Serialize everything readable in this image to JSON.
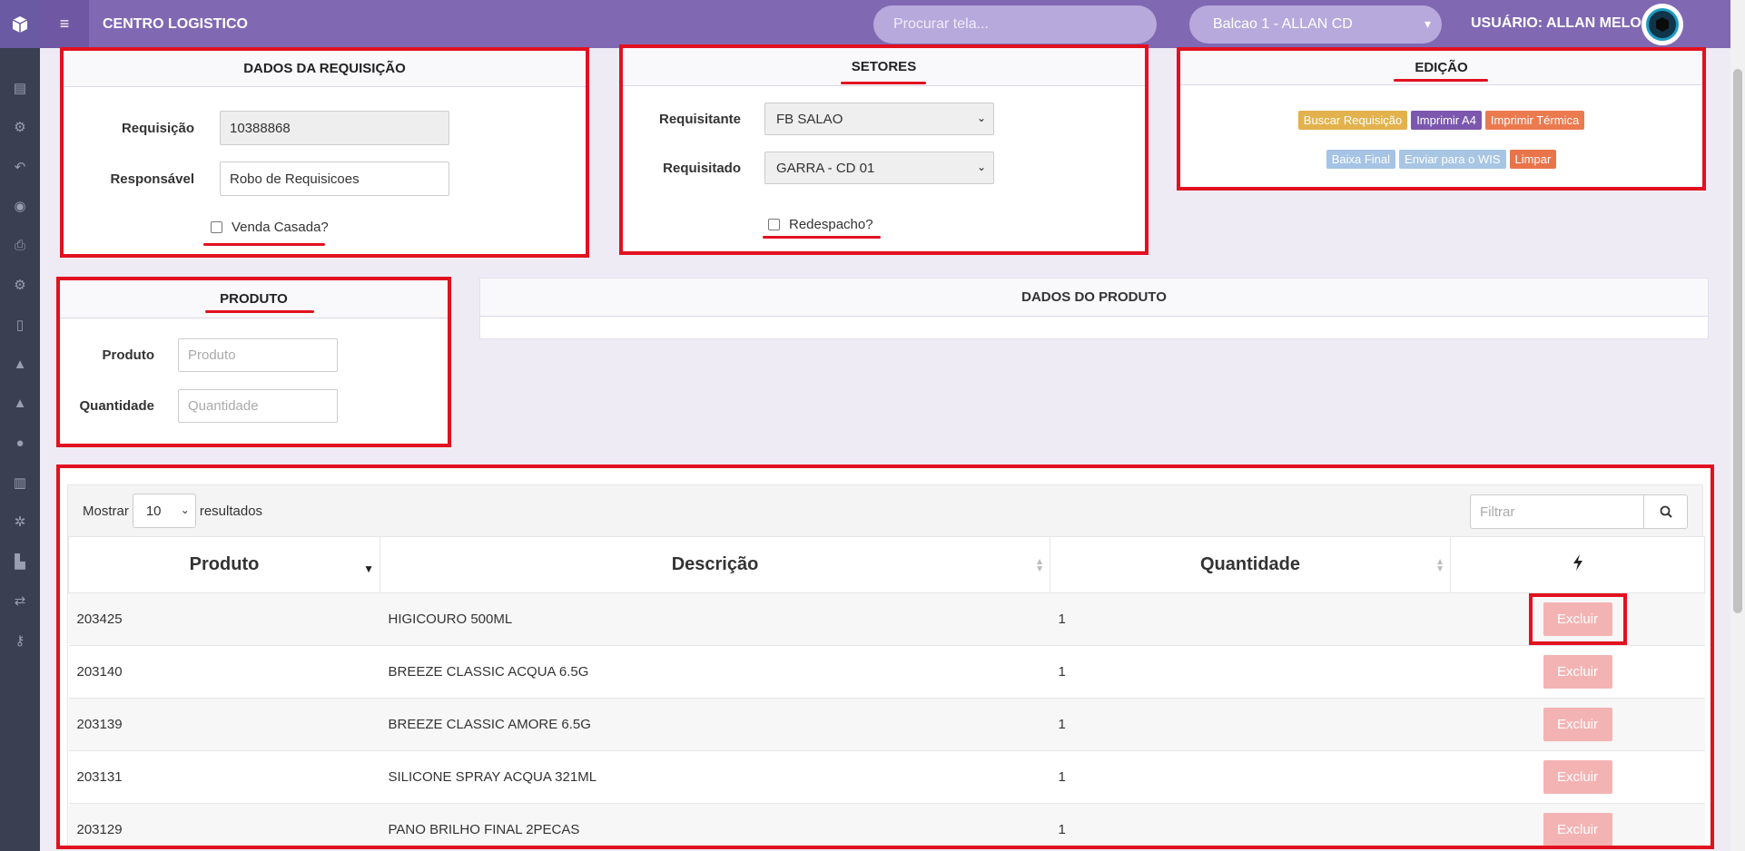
{
  "sidebar": {
    "logo_icon": "box-icon",
    "items": [
      "book-icon",
      "boxes-icon",
      "reply-icon",
      "eye-icon",
      "print-icon",
      "cubes-icon",
      "mobile-icon",
      "road-icon",
      "road-icon",
      "user-icon",
      "bar-chart-icon",
      "cogs-icon",
      "forklift-icon",
      "exchange-icon",
      "key-icon"
    ]
  },
  "topbar": {
    "title": "CENTRO LOGISTICO",
    "search_placeholder": "Procurar tela...",
    "balcao": "Balcao 1 - ALLAN CD",
    "user": "USUÁRIO: ALLAN MELO"
  },
  "requisicao": {
    "title": "DADOS DA REQUISIÇÃO",
    "requisicao_label": "Requisição",
    "requisicao_value": "10388868",
    "responsavel_label": "Responsável",
    "responsavel_value": "Robo de Requisicoes",
    "venda_casada": "Venda Casada?"
  },
  "setores": {
    "title": "SETORES",
    "requisitante_label": "Requisitante",
    "requisitante_value": "FB SALAO",
    "requisitado_label": "Requisitado",
    "requisitado_value": "GARRA - CD 01",
    "redespacho": "Redespacho?"
  },
  "edicao": {
    "title": "EDIÇÃO",
    "buttons": [
      "Buscar Requisição",
      "Imprimir A4",
      "Imprimir Térmica",
      "Baixa Final",
      "Enviar para o WIS",
      "Limpar"
    ]
  },
  "produto": {
    "title": "PRODUTO",
    "produto_label": "Produto",
    "produto_placeholder": "Produto",
    "quantidade_label": "Quantidade",
    "quantidade_placeholder": "Quantidade"
  },
  "dados_produto": {
    "title": "DADOS DO PRODUTO"
  },
  "table": {
    "show_label": "Mostrar",
    "page_size": "10",
    "results_label": "resultados",
    "filter_placeholder": "Filtrar",
    "headers": [
      "Produto",
      "Descrição",
      "Quantidade"
    ],
    "action_icon": "bolt-icon",
    "action_label": "Excluir",
    "rows": [
      {
        "produto": "203425",
        "descricao": "HIGICOURO 500ML",
        "quantidade": "1"
      },
      {
        "produto": "203140",
        "descricao": "BREEZE CLASSIC ACQUA 6.5G",
        "quantidade": "1"
      },
      {
        "produto": "203139",
        "descricao": "BREEZE CLASSIC AMORE 6.5G",
        "quantidade": "1"
      },
      {
        "produto": "203131",
        "descricao": "SILICONE SPRAY ACQUA 321ML",
        "quantidade": "1"
      },
      {
        "produto": "203129",
        "descricao": "PANO BRILHO FINAL 2PECAS",
        "quantidade": "1"
      }
    ]
  },
  "colors": {
    "accent": "#8068b3",
    "highlight": "#e2111f"
  }
}
